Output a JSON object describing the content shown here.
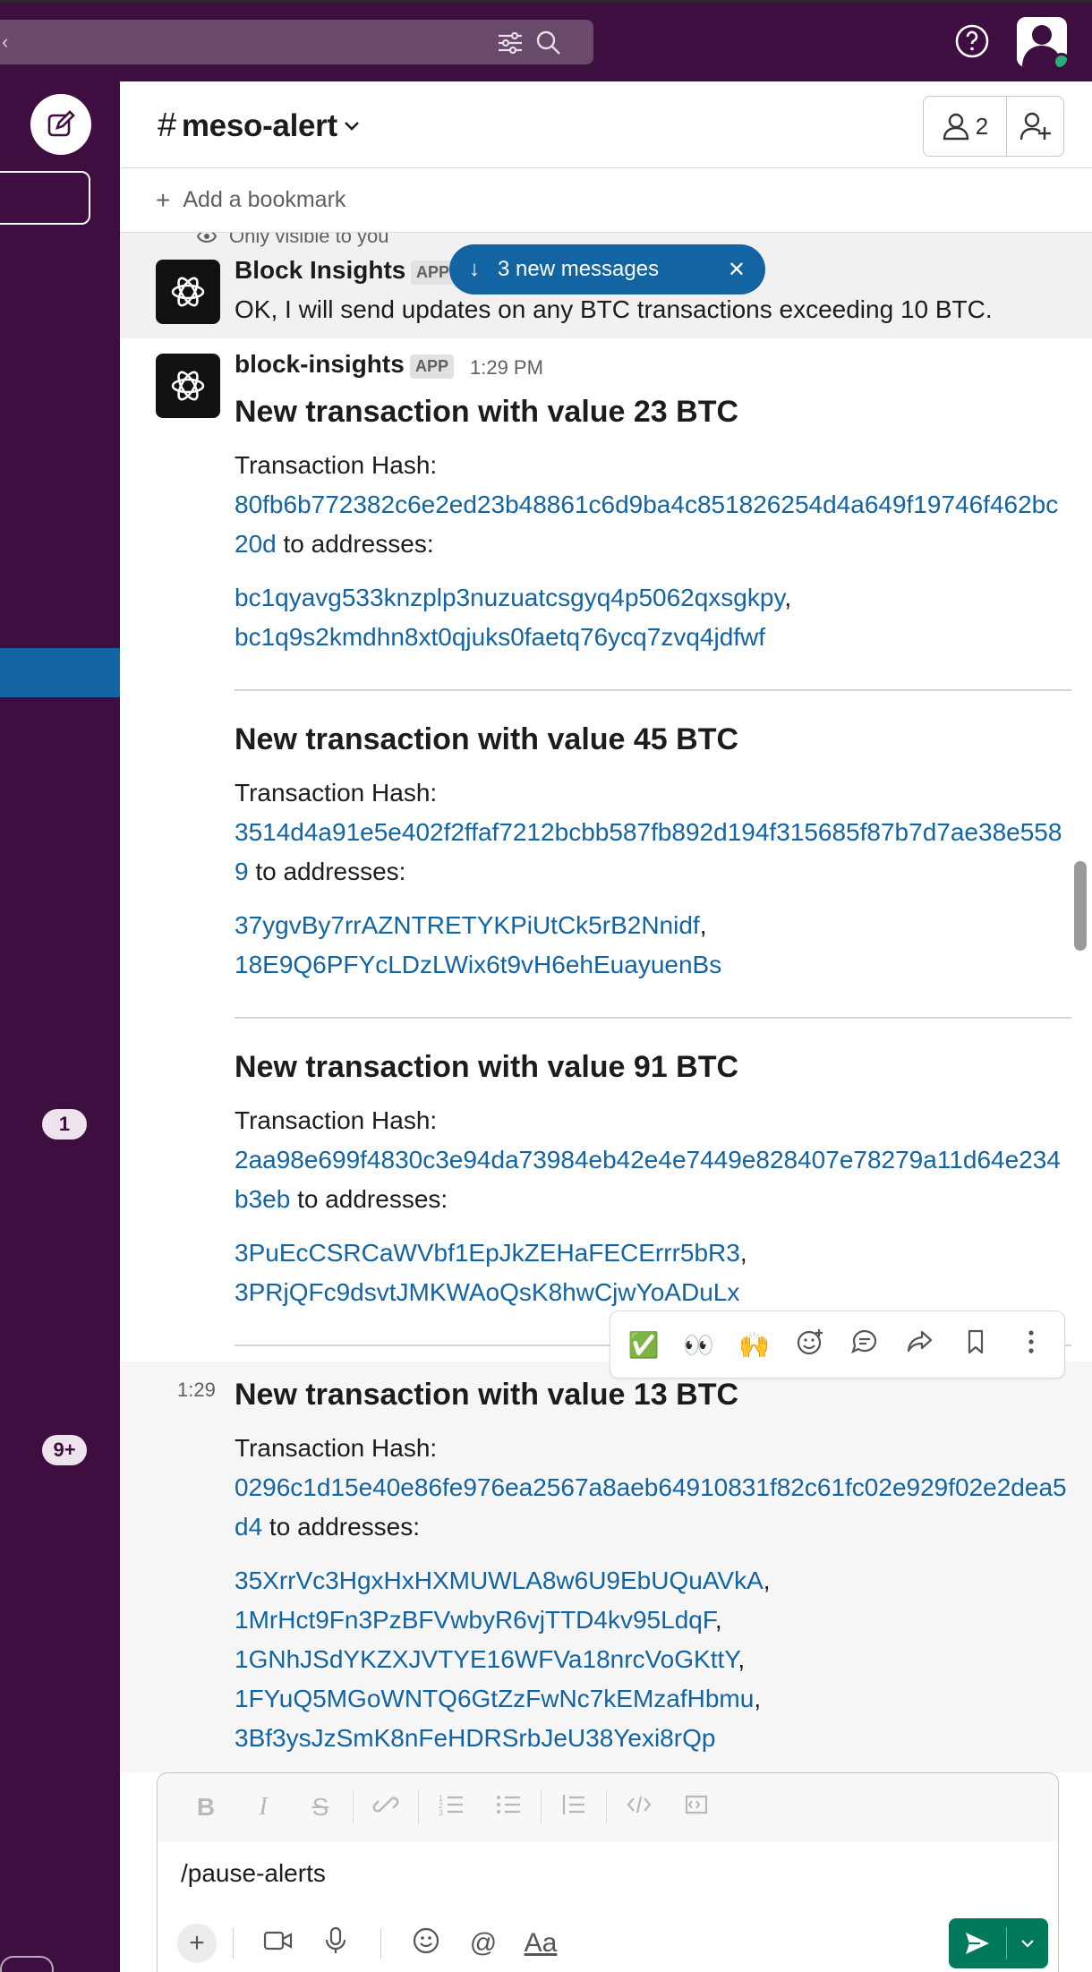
{
  "header": {
    "channel_hash": "#",
    "channel_name": "meso-alert",
    "member_count": "2"
  },
  "bookmark": {
    "label": "Add a bookmark"
  },
  "sidebar": {
    "badges": [
      "1",
      "9+"
    ]
  },
  "ephemeral": {
    "visibility": "Only visible to you",
    "sender": "Block Insights",
    "app_tag": "APP",
    "text": "OK, I will send updates on any BTC transactions exceeding 10 BTC."
  },
  "new_messages_pill": {
    "label": "3 new messages"
  },
  "message": {
    "sender": "block-insights",
    "app_tag": "APP",
    "time": "1:29 PM",
    "hover_time": "1:29"
  },
  "transactions": [
    {
      "heading": "New transaction with value 23 BTC",
      "hash_label": "Transaction Hash:",
      "hash": "80fb6b772382c6e2ed23b48861c6d9ba4c851826254d4a649f19746f462bc20d",
      "to_label": " to addresses:",
      "addresses": [
        "bc1qyavg533knzplp3nuzuatcsgyq4p5062qxsgkpy",
        "bc1q9s2kmdhn8xt0qjuks0faetq76ycq7zvq4jdfwf"
      ]
    },
    {
      "heading": "New transaction with value 45 BTC",
      "hash_label": "Transaction Hash:",
      "hash": "3514d4a91e5e402f2ffaf7212bcbb587fb892d194f315685f87b7d7ae38e5589",
      "to_label": " to addresses:",
      "addresses": [
        "37ygvBy7rrAZNTRETYKPiUtCk5rB2Nnidf",
        "18E9Q6PFYcLDzLWix6t9vH6ehEuayuenBs"
      ]
    },
    {
      "heading": "New transaction with value 91 BTC",
      "hash_label": "Transaction Hash:",
      "hash": "2aa98e699f4830c3e94da73984eb42e4e7449e828407e78279a11d64e234b3eb",
      "to_label": " to addresses:",
      "addresses": [
        "3PuEcCSRCaWVbf1EpJkZEHaFECErrr5bR3",
        "3PRjQFc9dsvtJMKWAoQsK8hwCjwYoADuLx"
      ]
    },
    {
      "heading": "New transaction with value 13 BTC",
      "hash_label": "Transaction Hash:",
      "hash": "0296c1d15e40e86fe976ea2567a8aeb64910831f82c61fc02e929f02e2dea5d4",
      "to_label": " to addresses:",
      "addresses": [
        "35XrrVc3HgxHxHXMUWLA8w6U9EbUQuAVkA",
        "1MrHct9Fn3PzBFVwbyR6vjTTD4kv95LdqF",
        "1GNhJSdYKZXJVTYE16WFVa18nrcVoGKttY",
        "1FYuQ5MGoWNTQ6GtZzFwNc7kEMzafHbmu",
        "3Bf3ysJzSmK8nFeHDRSrbJeU38Yexi8rQp"
      ]
    }
  ],
  "actions": {
    "items": [
      "✅",
      "👀",
      "🙌",
      "add-reaction-icon",
      "reply-in-thread-icon",
      "share-icon",
      "bookmark-icon",
      "more-icon"
    ]
  },
  "composer": {
    "value": "/pause-alerts",
    "format_label": "Aa"
  },
  "colors": {
    "aubergine": "#3f0e40",
    "link": "#1264a3",
    "send": "#007a5a",
    "active": "#1264a3"
  }
}
